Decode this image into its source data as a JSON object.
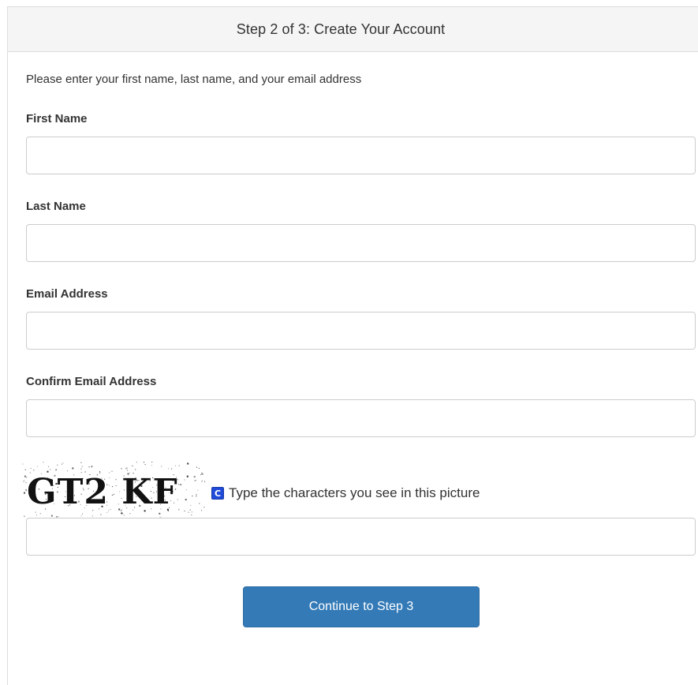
{
  "header": {
    "title": "Step 2 of 3: Create Your Account"
  },
  "form": {
    "instructions": "Please enter your first name, last name, and your email address",
    "first_name": {
      "label": "First Name",
      "value": ""
    },
    "last_name": {
      "label": "Last Name",
      "value": ""
    },
    "email": {
      "label": "Email Address",
      "value": ""
    },
    "confirm_email": {
      "label": "Confirm Email Address",
      "value": ""
    },
    "captcha": {
      "image_text": "GT2 KF",
      "refresh_icon": "refresh-icon",
      "refresh_glyph": "C",
      "instruction": "Type the characters you see in this picture",
      "value": ""
    },
    "submit_label": "Continue to Step 3"
  },
  "colors": {
    "header_bg": "#f5f5f5",
    "button_bg": "#337ab7",
    "refresh_icon_bg": "#1f4bd8"
  }
}
